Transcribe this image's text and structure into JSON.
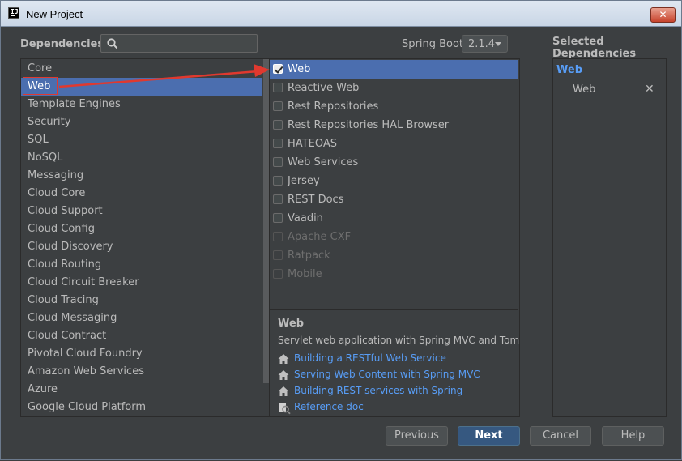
{
  "window": {
    "title": "New Project",
    "app_icon_text": "IJ",
    "close_label": "✕"
  },
  "header": {
    "dependencies_label": "Dependencies",
    "search": {
      "value": "",
      "placeholder": ""
    },
    "spring_boot_label": "Spring Boot",
    "spring_boot_version": "2.1.4",
    "selected_label": "Selected Dependencies"
  },
  "categories": {
    "selected_index": 1,
    "items": [
      "Core",
      "Web",
      "Template Engines",
      "Security",
      "SQL",
      "NoSQL",
      "Messaging",
      "Cloud Core",
      "Cloud Support",
      "Cloud Config",
      "Cloud Discovery",
      "Cloud Routing",
      "Cloud Circuit Breaker",
      "Cloud Tracing",
      "Cloud Messaging",
      "Cloud Contract",
      "Pivotal Cloud Foundry",
      "Amazon Web Services",
      "Azure",
      "Google Cloud Platform"
    ]
  },
  "dependencies": {
    "items": [
      {
        "label": "Web",
        "checked": true,
        "selected": true,
        "enabled": true
      },
      {
        "label": "Reactive Web",
        "checked": false,
        "selected": false,
        "enabled": true
      },
      {
        "label": "Rest Repositories",
        "checked": false,
        "selected": false,
        "enabled": true
      },
      {
        "label": "Rest Repositories HAL Browser",
        "checked": false,
        "selected": false,
        "enabled": true
      },
      {
        "label": "HATEOAS",
        "checked": false,
        "selected": false,
        "enabled": true
      },
      {
        "label": "Web Services",
        "checked": false,
        "selected": false,
        "enabled": true
      },
      {
        "label": "Jersey",
        "checked": false,
        "selected": false,
        "enabled": true
      },
      {
        "label": "REST Docs",
        "checked": false,
        "selected": false,
        "enabled": true
      },
      {
        "label": "Vaadin",
        "checked": false,
        "selected": false,
        "enabled": true
      },
      {
        "label": "Apache CXF",
        "checked": false,
        "selected": false,
        "enabled": false
      },
      {
        "label": "Ratpack",
        "checked": false,
        "selected": false,
        "enabled": false
      },
      {
        "label": "Mobile",
        "checked": false,
        "selected": false,
        "enabled": false
      }
    ]
  },
  "info": {
    "title": "Web",
    "description": "Servlet web application with Spring MVC and Tomcat",
    "links": [
      {
        "icon": "home-icon",
        "label": "Building a RESTful Web Service"
      },
      {
        "icon": "home-icon",
        "label": "Serving Web Content with Spring MVC"
      },
      {
        "icon": "home-icon",
        "label": "Building REST services with Spring"
      },
      {
        "icon": "reference-doc-icon",
        "label": "Reference doc"
      }
    ]
  },
  "selected": {
    "group": "Web",
    "items": [
      {
        "label": "Web",
        "remove": "✕"
      }
    ]
  },
  "buttons": {
    "previous": "Previous",
    "next": "Next",
    "cancel": "Cancel",
    "help": "Help"
  },
  "colors": {
    "background": "#3c3f41",
    "selection": "#4b6eaf",
    "link": "#589df6",
    "annotation": "#e0392f",
    "default_button": "#365880"
  }
}
